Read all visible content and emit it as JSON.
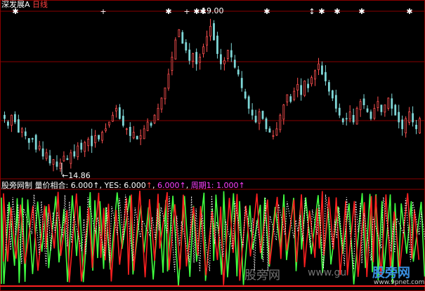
{
  "header": {
    "stock_name": "深发展A",
    "period": "日线"
  },
  "annotations": {
    "high_label": "19.00",
    "low_label": "←14.86"
  },
  "indicator": {
    "source": "股旁网制",
    "name": "量价相合:",
    "value1": "6.000",
    "yes_label": "YES:",
    "yes_value": "6.000",
    "value2": "6.000",
    "cycle_label": "周期1:",
    "cycle_value": "1.000",
    "arrow": "↑"
  },
  "watermarks": {
    "site": "股旁网",
    "url": "www.gu",
    "brand": "股旁网",
    "brand_url": "www.9pnet.com"
  },
  "colors": {
    "background": "#000000",
    "grid": "#8a0000",
    "up": "#ff5050",
    "down": "#7fd7d7",
    "green_line": "#40ff40",
    "red_line": "#ff2020",
    "white_dotted": "#ffffff",
    "markers": "#ffffff"
  },
  "chart_data": [
    {
      "type": "candlestick",
      "title": "深发展A 日线",
      "marked_high": 19.0,
      "marked_low": 14.86,
      "close_series": [
        16.3,
        16.1,
        16.4,
        16.2,
        15.9,
        16.0,
        15.8,
        15.6,
        15.7,
        15.4,
        15.5,
        15.2,
        15.3,
        15.0,
        15.1,
        14.9,
        15.0,
        15.2,
        15.1,
        15.3,
        15.2,
        15.5,
        15.4,
        15.6,
        15.7,
        15.5,
        15.8,
        15.7,
        15.9,
        16.0,
        16.2,
        16.4,
        16.6,
        16.3,
        16.1,
        16.0,
        15.8,
        15.9,
        15.7,
        15.8,
        16.0,
        16.2,
        16.1,
        16.4,
        16.6,
        16.9,
        17.2,
        17.6,
        18.1,
        18.6,
        18.9,
        18.5,
        18.3,
        18.0,
        18.2,
        17.9,
        18.1,
        18.4,
        18.7,
        19.0,
        18.6,
        18.2,
        17.9,
        18.0,
        18.3,
        18.1,
        17.8,
        17.6,
        17.2,
        16.9,
        16.6,
        16.4,
        16.2,
        16.5,
        16.3,
        16.0,
        15.9,
        15.8,
        16.0,
        16.4,
        16.7,
        17.0,
        16.8,
        17.1,
        17.3,
        17.0,
        17.4,
        17.2,
        17.5,
        17.7,
        17.9,
        17.6,
        17.4,
        17.1,
        16.9,
        16.6,
        16.4,
        16.2,
        16.3,
        16.5,
        16.2,
        16.6,
        16.8,
        16.7,
        16.5,
        16.3,
        16.6,
        16.8,
        16.5,
        16.7,
        16.9,
        16.6,
        16.4,
        16.2,
        16.0,
        16.3,
        16.5,
        16.2,
        16.0,
        16.3
      ]
    },
    {
      "type": "line",
      "title": "量价相合",
      "series": [
        {
          "name": "YES",
          "color": "green"
        },
        {
          "name": "周期1",
          "color": "red"
        }
      ],
      "ylim": [
        0,
        6
      ]
    }
  ]
}
